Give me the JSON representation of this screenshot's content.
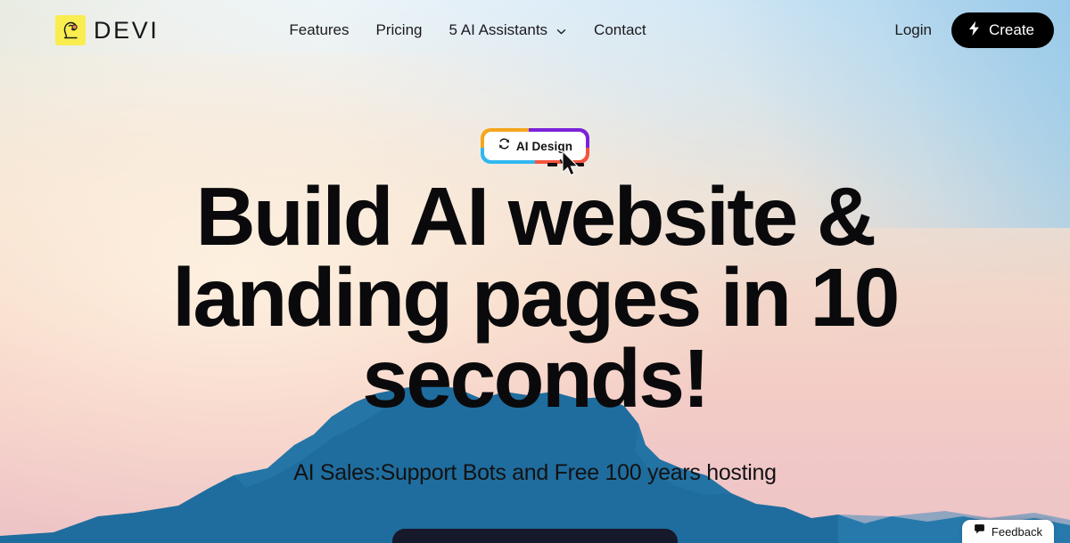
{
  "brand": {
    "name": "DEVI",
    "logo_icon": "face-profile-icon",
    "logo_bg_color": "#f9ed4f"
  },
  "nav": {
    "items": [
      {
        "label": "Features",
        "has_chevron": false
      },
      {
        "label": "Pricing",
        "has_chevron": false
      },
      {
        "label": "5 AI Assistants",
        "has_chevron": true
      },
      {
        "label": "Contact",
        "has_chevron": false
      }
    ]
  },
  "header_actions": {
    "login_label": "Login",
    "create_label": "Create",
    "create_icon": "lightning-bolt-icon",
    "create_bg_color": "#000000"
  },
  "hero": {
    "badge": {
      "label": "AI Design",
      "icon": "refresh-icon",
      "border_colors": {
        "orange": "#f5a61d",
        "purple": "#7b22d9",
        "cyan": "#30b8f0",
        "red": "#f4543f"
      }
    },
    "headline_line1": "Build AI website &",
    "headline_line2": "landing pages in 10",
    "headline_line3": "seconds!",
    "subheadline": "AI Sales:Support Bots and Free 100 years hosting"
  },
  "feedback": {
    "label": "Feedback",
    "icon": "speech-bubble-icon"
  },
  "theme": {
    "text_color": "#0a0a0c",
    "panel_color": "#16192b",
    "mountain_color": "#1f6d9e"
  }
}
